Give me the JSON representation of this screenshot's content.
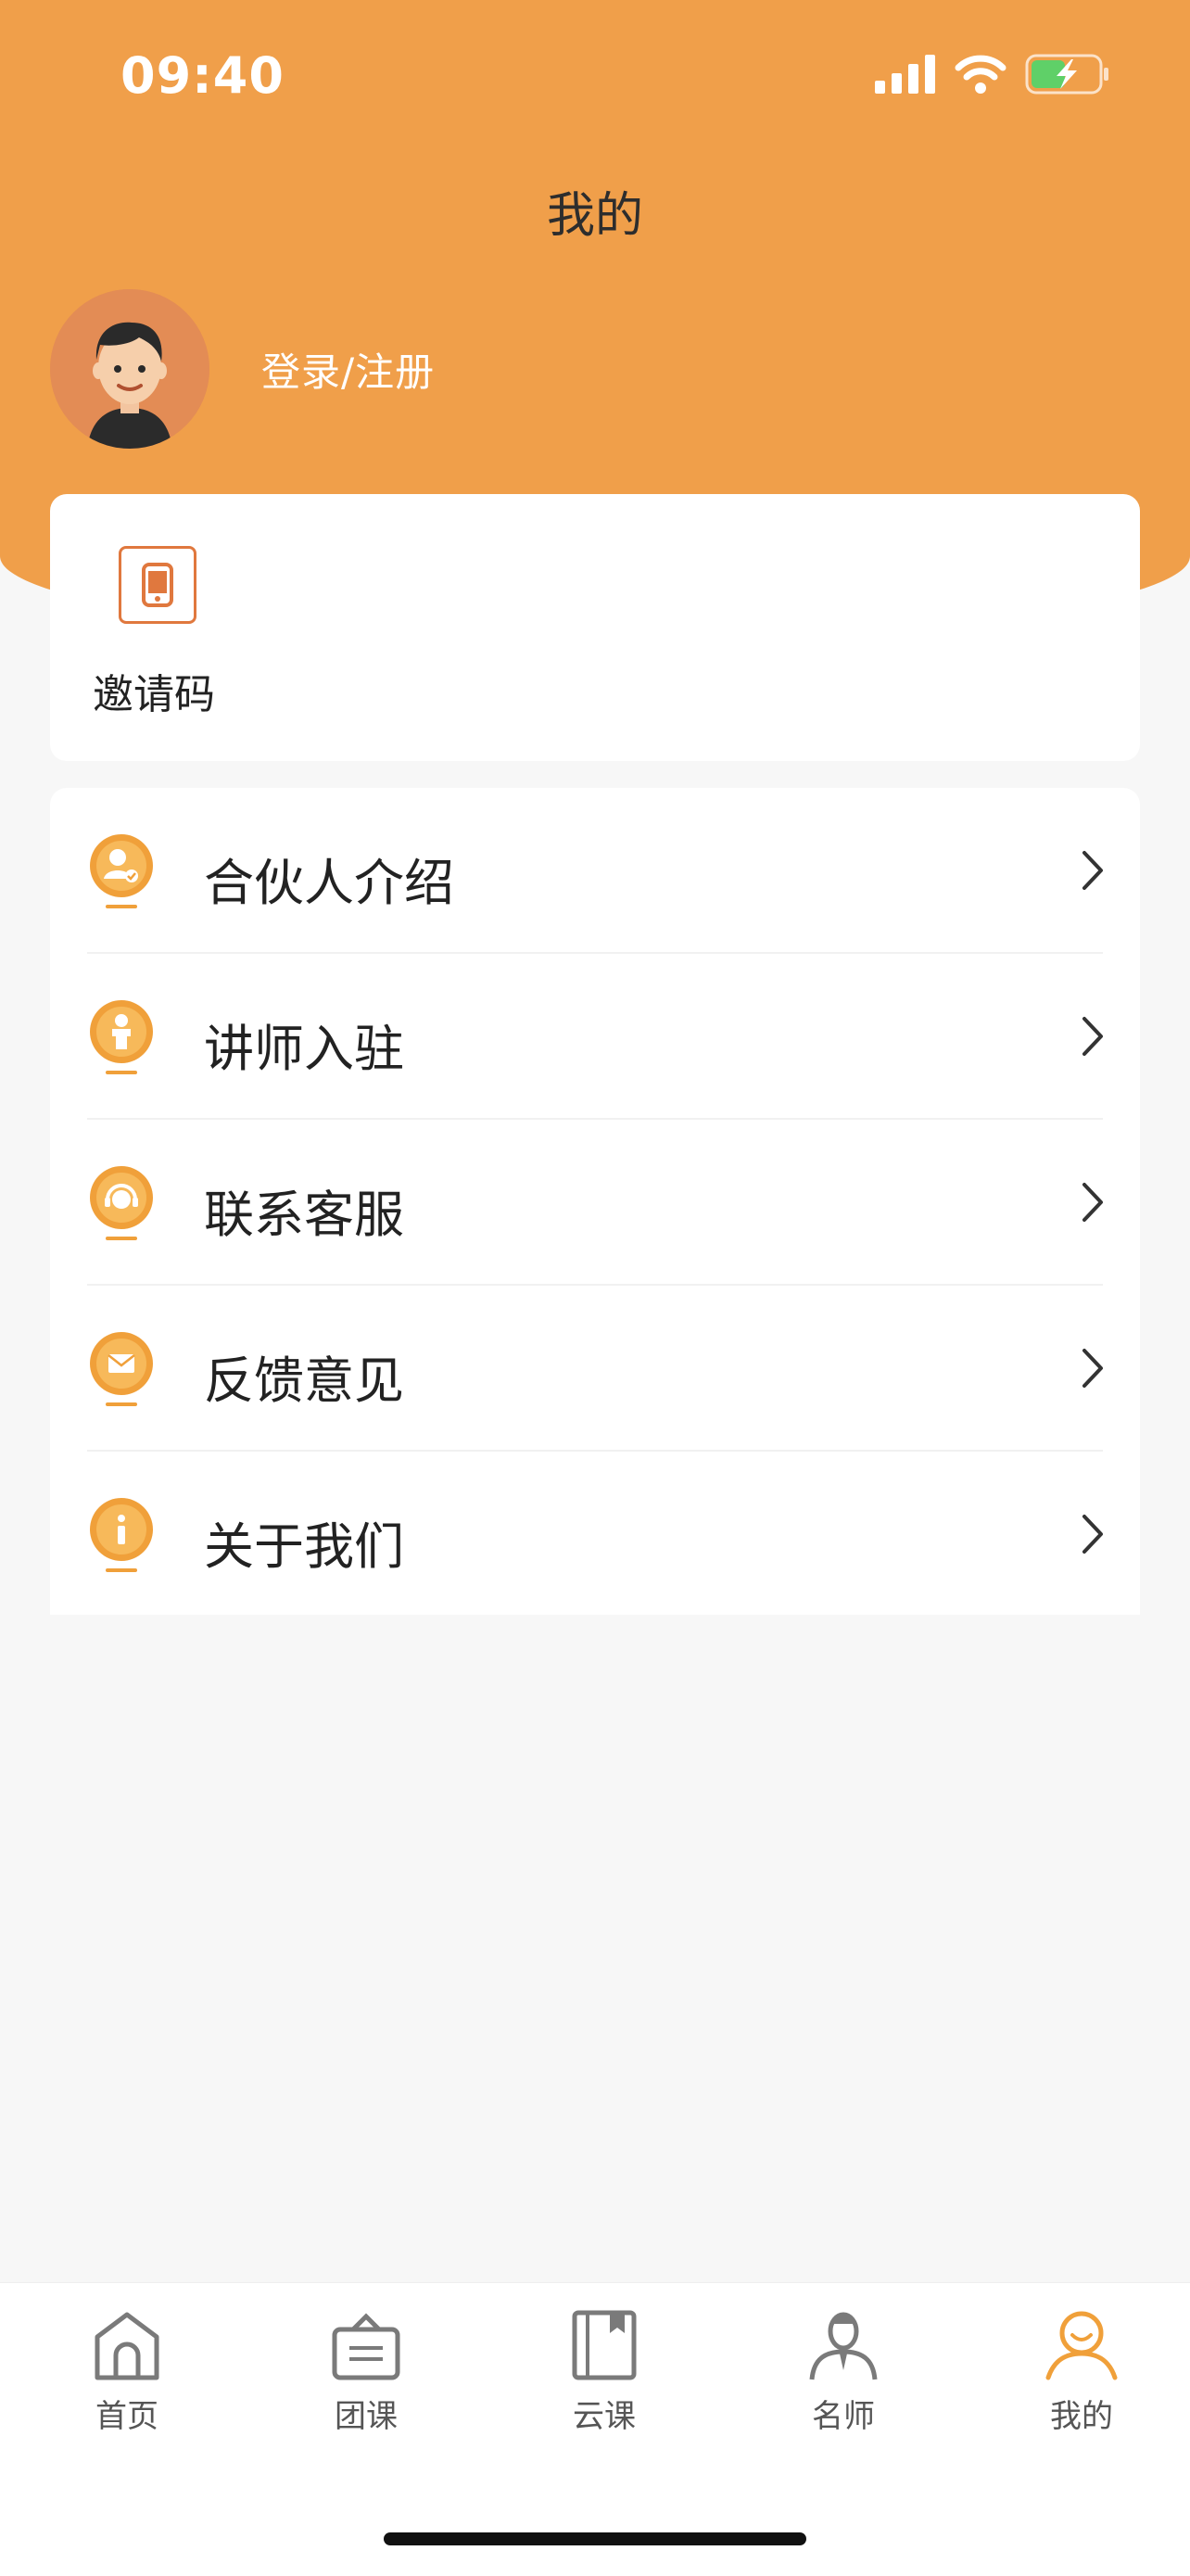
{
  "status_bar": {
    "time": "09:40"
  },
  "header": {
    "title": "我的"
  },
  "profile": {
    "login_label": "登录/注册"
  },
  "invite": {
    "label": "邀请码"
  },
  "menu": {
    "items": [
      {
        "label": "合伙人介绍",
        "icon": "partner-icon"
      },
      {
        "label": "讲师入驻",
        "icon": "lecturer-icon"
      },
      {
        "label": "联系客服",
        "icon": "customer-service-icon"
      },
      {
        "label": "反馈意见",
        "icon": "feedback-icon"
      },
      {
        "label": "关于我们",
        "icon": "info-icon"
      }
    ]
  },
  "tabbar": {
    "tabs": [
      {
        "label": "首页",
        "icon": "home-icon"
      },
      {
        "label": "团课",
        "icon": "group-class-icon"
      },
      {
        "label": "云课",
        "icon": "cloud-class-icon"
      },
      {
        "label": "名师",
        "icon": "teacher-icon"
      },
      {
        "label": "我的",
        "icon": "profile-icon",
        "active": true
      }
    ]
  },
  "colors": {
    "brand": "#f09f4a",
    "icon_orange": "#f0a03a",
    "icon_border": "#e0783e",
    "background": "#f7f7f7"
  }
}
